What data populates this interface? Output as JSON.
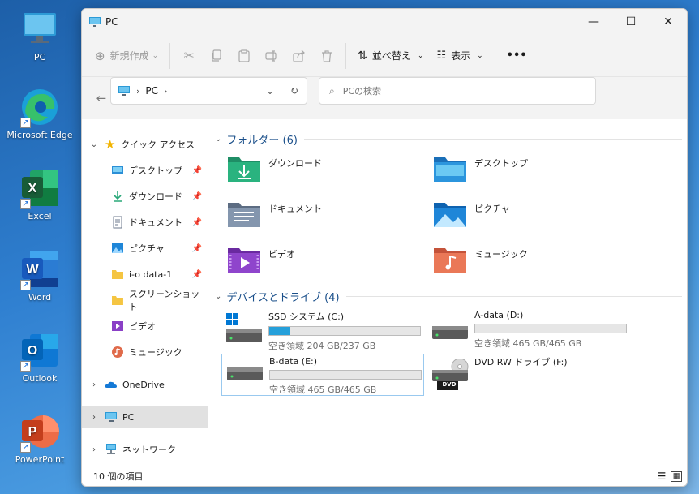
{
  "desktop": {
    "icons": [
      {
        "label": "PC",
        "icon": "pc-icon"
      },
      {
        "label": "Microsoft Edge",
        "icon": "edge-icon"
      },
      {
        "label": "Excel",
        "icon": "excel-icon"
      },
      {
        "label": "Word",
        "icon": "word-icon"
      },
      {
        "label": "Outlook",
        "icon": "outlook-icon"
      },
      {
        "label": "PowerPoint",
        "icon": "powerpoint-icon"
      }
    ]
  },
  "window": {
    "title": "PC",
    "controls": {
      "minimize": "—",
      "maximize": "☐",
      "close": "✕"
    }
  },
  "toolbar": {
    "new_label": "新規作成",
    "sort_label": "並べ替え",
    "view_label": "表示",
    "more_label": "•••"
  },
  "address": {
    "segment": "PC",
    "chevron": "›"
  },
  "search": {
    "placeholder": "PCの検索"
  },
  "sidebar": {
    "items": [
      {
        "label": "クイック アクセス",
        "expand": "⌄",
        "pinned": false
      },
      {
        "label": "デスクトップ",
        "expand": "",
        "pinned": true
      },
      {
        "label": "ダウンロード",
        "expand": "",
        "pinned": true
      },
      {
        "label": "ドキュメント",
        "expand": "",
        "pinned": true
      },
      {
        "label": "ピクチャ",
        "expand": "",
        "pinned": true
      },
      {
        "label": "i-o data-1",
        "expand": "",
        "pinned": true
      },
      {
        "label": "スクリーンショット",
        "expand": "",
        "pinned": false
      },
      {
        "label": "ビデオ",
        "expand": "",
        "pinned": false
      },
      {
        "label": "ミュージック",
        "expand": "",
        "pinned": false
      },
      {
        "label": "OneDrive",
        "expand": "›",
        "pinned": false
      },
      {
        "label": "PC",
        "expand": "›",
        "pinned": false,
        "selected": true
      },
      {
        "label": "ネットワーク",
        "expand": "›",
        "pinned": false
      }
    ],
    "pin_glyph": "📌"
  },
  "content": {
    "folders_header": "フォルダー (6)",
    "folders": [
      {
        "label": "ダウンロード",
        "icon": "downloads-folder-icon",
        "color": "#2aa879"
      },
      {
        "label": "デスクトップ",
        "icon": "desktop-folder-icon",
        "color": "#2b8fd6"
      },
      {
        "label": "ドキュメント",
        "icon": "documents-folder-icon",
        "color": "#7d8fa8"
      },
      {
        "label": "ピクチャ",
        "icon": "pictures-folder-icon",
        "color": "#1f86d8"
      },
      {
        "label": "ビデオ",
        "icon": "videos-folder-icon",
        "color": "#8a3fc6"
      },
      {
        "label": "ミュージック",
        "icon": "music-folder-icon",
        "color": "#e06a4a"
      }
    ],
    "drives_header": "デバイスとドライブ (4)",
    "drives": [
      {
        "label": "SSD システム (C:)",
        "free": "空き領域 204 GB/237 GB",
        "used_fraction": 0.14,
        "selected": false,
        "has_bar": true,
        "icon": "system-drive-icon"
      },
      {
        "label": "A-data (D:)",
        "free": "空き領域 465 GB/465 GB",
        "used_fraction": 0.0,
        "selected": false,
        "has_bar": true,
        "icon": "hard-drive-icon"
      },
      {
        "label": "B-data (E:)",
        "free": "空き領域 465 GB/465 GB",
        "used_fraction": 0.0,
        "selected": true,
        "has_bar": true,
        "icon": "hard-drive-icon"
      },
      {
        "label": "DVD RW ドライブ (F:)",
        "free": "",
        "used_fraction": 0.0,
        "selected": false,
        "has_bar": false,
        "icon": "dvd-drive-icon",
        "badge": "DVD"
      }
    ]
  },
  "status": {
    "item_count": "10 個の項目"
  }
}
